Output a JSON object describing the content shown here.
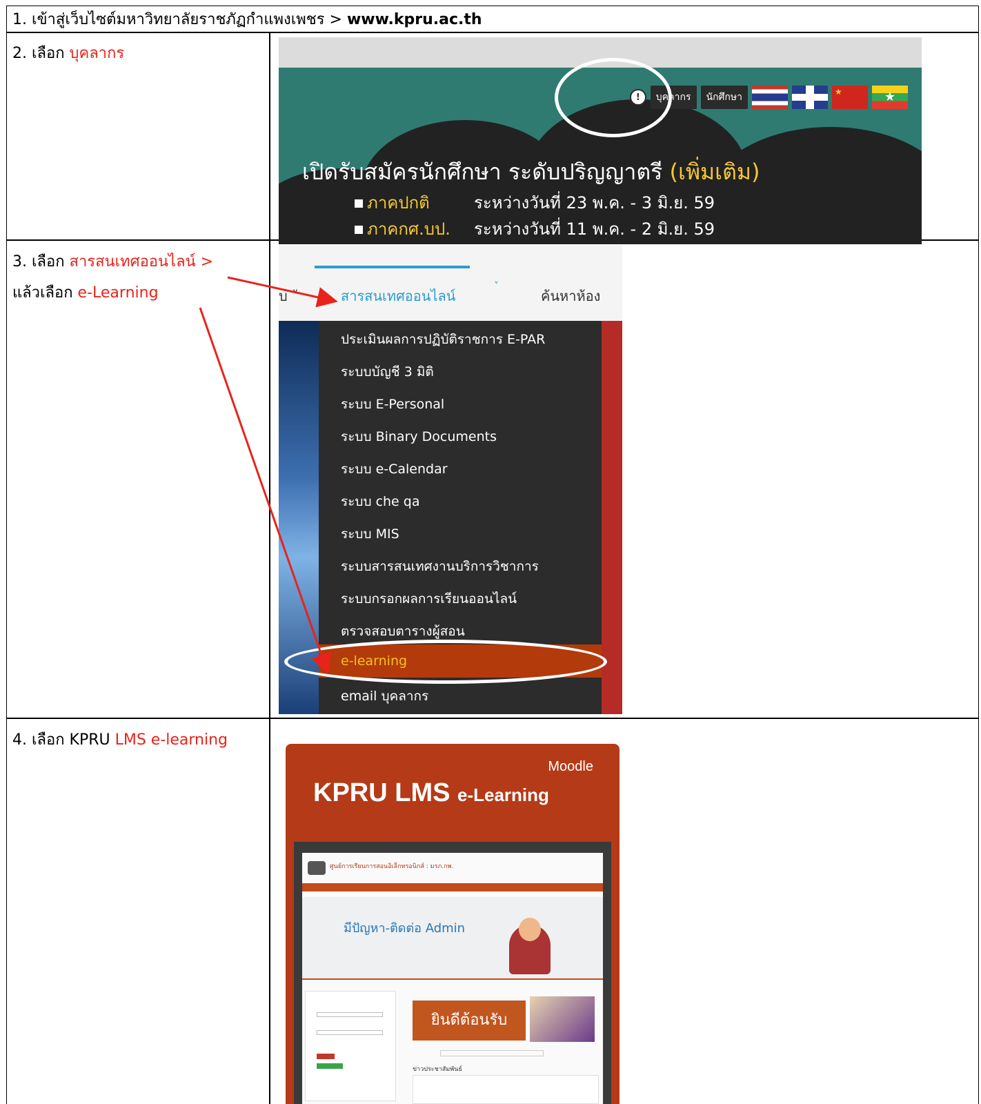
{
  "step1": {
    "text": "1. เข้าสู่เว็บไซต์มหาวิทยาลัยราชภัฏกำแพงเพชร > ",
    "url": "www.kpru.ac.th"
  },
  "step2": {
    "prefix": "2. เลือก ",
    "target": "บุคลากร",
    "screenshot": {
      "staff_button": "บุคลากร",
      "student_button": "นักศึกษา",
      "headline_main": "เปิดรับสมัครนักศึกษา ระดับปริญญาตรี ",
      "headline_extra": "(เพิ่มเติม)",
      "line1_label": "ภาคปกติ",
      "line1_text": "ระหว่างวันที่ 23 พ.ค. - 3 มิ.ย. 59",
      "line2_label": "ภาคกศ.บป.",
      "line2_text": "ระหว่างวันที่ 11 พ.ค. - 2 มิ.ย. 59"
    }
  },
  "step3": {
    "prefix": "3. เลือก ",
    "target": "สารสนเทศออนไลน์ >",
    "line2_prefix": "แล้วเลือก  ",
    "line2_target": "e-Learning",
    "screenshot": {
      "nav_prev": "บ ˅",
      "nav_active": "สารสนเทศออนไลน์",
      "nav_next": "ค้นหาห้อง",
      "menu_items": [
        "ประเมินผลการปฏิบัติราชการ E-PAR",
        "ระบบบัญชี 3 มิติ",
        "ระบบ E-Personal",
        "ระบบ Binary Documents",
        "ระบบ e-Calendar",
        "ระบบ che qa",
        "ระบบ MIS",
        "ระบบสารสนเทศงานบริการวิชาการ",
        "ระบบกรอกผลการเรียนออนไลน์",
        "ตรวจสอบตารางผู้สอน",
        "e-learning",
        "email บุคลากร"
      ],
      "highlighted_index": 10
    }
  },
  "step4": {
    "prefix": "4. เลือก KPRU ",
    "target": "LMS e-learning",
    "screenshot": {
      "moodle": "Moodle",
      "title_main": "KPRU LMS ",
      "title_small": "e-Learning",
      "site_name": "ศูนย์การเรียนการสอนอิเล็กทรอนิกส์ : มรภ.กพ.",
      "banner_title": "มีปัญหา-ติดต่อ Admin",
      "welcome": "ยินดีต้อนรับ",
      "news_title": "ข่าวประชาสัมพันธ์"
    }
  },
  "colors": {
    "accent_red": "#e8231c",
    "teal": "#2f7b72",
    "menu_dark": "#2c2c2c",
    "menu_highlight": "#b33a0b",
    "moodle_red": "#b53a17"
  }
}
